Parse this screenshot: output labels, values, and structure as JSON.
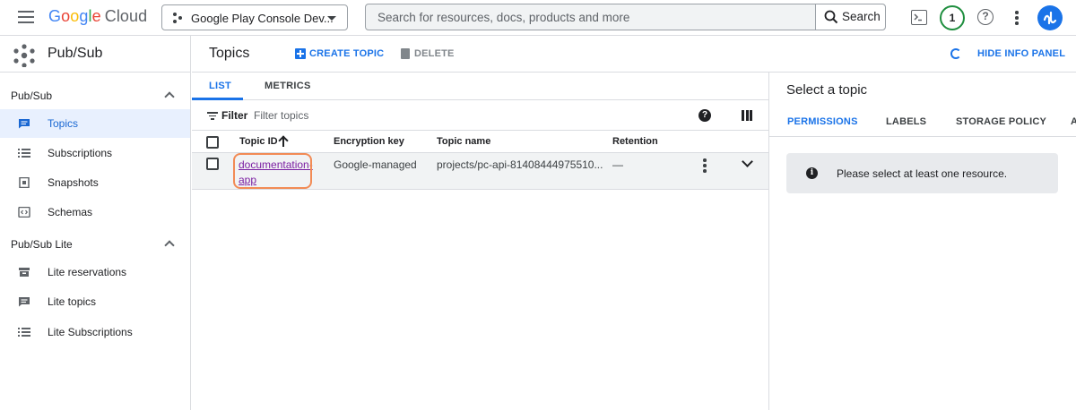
{
  "topbar": {
    "logo_google": "Google",
    "logo_cloud": "Cloud",
    "project": "Google Play Console Dev...",
    "search_placeholder": "Search for resources, docs, products and more",
    "search_button": "Search",
    "notifications_count": "1",
    "help": "?"
  },
  "sidebar": {
    "product_title": "Pub/Sub",
    "sections": [
      {
        "title": "Pub/Sub",
        "items": [
          {
            "label": "Topics",
            "icon": "topics-icon",
            "active": true
          },
          {
            "label": "Subscriptions",
            "icon": "list-icon"
          },
          {
            "label": "Snapshots",
            "icon": "snapshot-icon"
          },
          {
            "label": "Schemas",
            "icon": "code-icon"
          }
        ]
      },
      {
        "title": "Pub/Sub Lite",
        "items": [
          {
            "label": "Lite reservations",
            "icon": "reservation-icon"
          },
          {
            "label": "Lite topics",
            "icon": "topics-icon"
          },
          {
            "label": "Lite Subscriptions",
            "icon": "list-icon"
          }
        ]
      }
    ]
  },
  "main": {
    "title": "Topics",
    "create_label": "CREATE TOPIC",
    "delete_label": "DELETE",
    "tabs": [
      {
        "label": "LIST",
        "active": true
      },
      {
        "label": "METRICS"
      }
    ],
    "filter_label": "Filter",
    "filter_placeholder": "Filter topics",
    "table": {
      "columns": [
        "Topic ID",
        "Encryption key",
        "Topic name",
        "Retention"
      ],
      "rows": [
        {
          "topic_id": "documentation-app",
          "encryption_key": "Google-managed",
          "topic_name": "projects/pc-api-81408444975510...",
          "retention": "—"
        }
      ]
    }
  },
  "info_panel": {
    "hide_label": "HIDE INFO PANEL",
    "title": "Select a topic",
    "tabs": [
      "PERMISSIONS",
      "LABELS",
      "STORAGE POLICY",
      "A"
    ],
    "notice": "Please select at least one resource."
  },
  "colors": {
    "accent": "#1a73e8",
    "active_nav_bg": "#e8f0fe",
    "notification_ring": "#1e8e3e",
    "highlight": "#f28b55",
    "visited_link": "#7b1fa2"
  }
}
